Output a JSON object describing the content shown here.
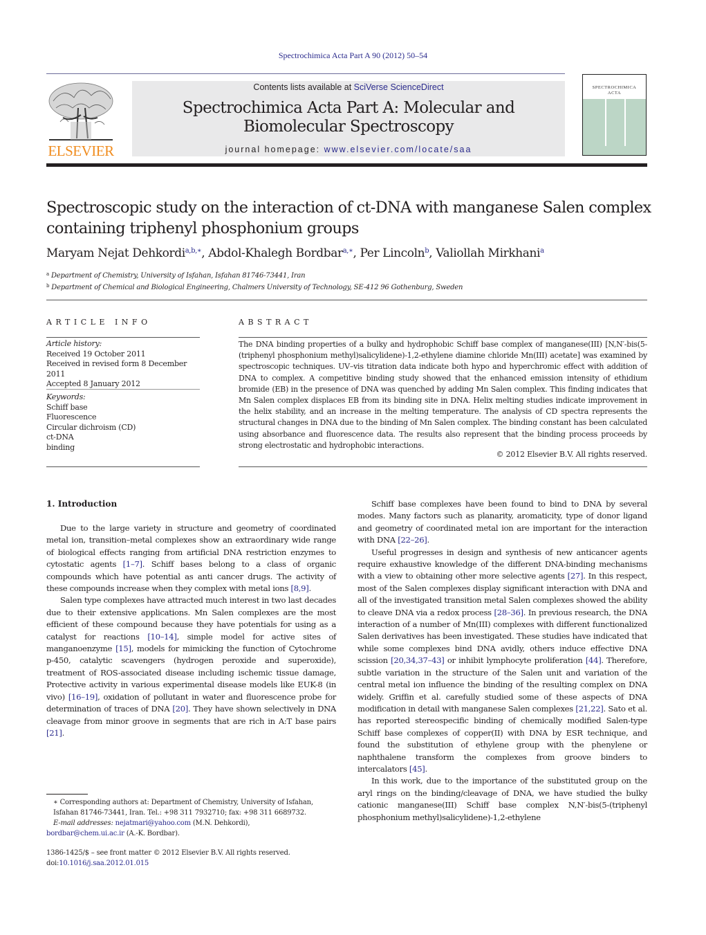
{
  "running_head": "Spectrochimica Acta Part A 90 (2012) 50–54",
  "banner": {
    "contents_prefix": "Contents lists available at ",
    "contents_link": "SciVerse ScienceDirect",
    "journal_title_line1": "Spectrochimica Acta Part A: Molecular and",
    "journal_title_line2": "Biomolecular Spectroscopy",
    "homepage_prefix": "journal homepage: ",
    "homepage_link": "www.elsevier.com/locate/saa"
  },
  "publisher_logo": {
    "icon": "elsevier-tree-logo",
    "text": "ELSEVIER",
    "color": "#f08c1e"
  },
  "cover": {
    "title_line1": "SPECTROCHIMICA",
    "title_line2": "ACTA",
    "color": "#bcd6c6"
  },
  "article": {
    "title_line1": "Spectroscopic study on the interaction of ct-DNA with manganese Salen complex",
    "title_line2": "containing triphenyl phosphonium groups",
    "authors": [
      {
        "name": "Maryam Nejat Dehkordi",
        "sup": "a,b,∗",
        "sep": ", "
      },
      {
        "name": "Abdol-Khalegh Bordbar",
        "sup": "a,∗",
        "sep": ", "
      },
      {
        "name": "Per Lincoln",
        "sup": "b",
        "sep": ", "
      },
      {
        "name": "Valiollah Mirkhani",
        "sup": "a",
        "sep": ""
      }
    ],
    "affiliations": [
      {
        "mark": "a",
        "text": "Department of Chemistry, University of Isfahan, Isfahan 81746-73441, Iran"
      },
      {
        "mark": "b",
        "text": "Department of Chemical and Biological Engineering, Chalmers University of Technology, SE-412 96 Gothenburg, Sweden"
      }
    ]
  },
  "article_info": {
    "heading": "ARTICLE INFO",
    "history_label": "Article history:",
    "history": [
      "Received 19 October 2011",
      "Received in revised form 8 December 2011",
      "Accepted 8 January 2012"
    ],
    "keywords_label": "Keywords:",
    "keywords": [
      "Schiff base",
      "Fluorescence",
      "Circular dichroism (CD)",
      "ct-DNA",
      "binding"
    ]
  },
  "abstract": {
    "heading": "ABSTRACT",
    "text": "The DNA binding properties of a bulky and hydrophobic Schiff base complex of manganese(III) [N,N′-bis(5-(triphenyl phosphonium methyl)salicylidene)-1,2-ethylene diamine chloride Mn(III) acetate] was examined by spectroscopic techniques. UV–vis titration data indicate both hypo and hyperchromic effect with addition of DNA to complex. A competitive binding study showed that the enhanced emission intensity of ethidium bromide (EB) in the presence of DNA was quenched by adding Mn Salen complex. This finding indicates that Mn Salen complex displaces EB from its binding site in DNA. Helix melting studies indicate improvement in the helix stability, and an increase in the melting temperature. The analysis of CD spectra represents the structural changes in DNA due to the binding of Mn Salen complex. The binding constant has been calculated using absorbance and fluorescence data. The results also represent that the binding process proceeds by strong electrostatic and hydrophobic interactions.",
    "copyright": "© 2012 Elsevier B.V. All rights reserved."
  },
  "introduction": {
    "heading": "1.  Introduction",
    "left_paragraphs": [
      [
        {
          "t": "Due to the large variety in structure and geometry of coordinated metal ion, transition–metal complexes show an extraordinary wide range of biological effects ranging from artificial DNA restriction enzymes to cytostatic agents "
        },
        {
          "ref": "[1–7]"
        },
        {
          "t": ". Schiff bases belong to a class of organic compounds which have potential as anti cancer drugs. The activity of these compounds increase when they complex with metal ions "
        },
        {
          "ref": "[8,9]"
        },
        {
          "t": "."
        }
      ],
      [
        {
          "t": "Salen type complexes have attracted much interest in two last decades due to their extensive applications. Mn Salen complexes are the most efficient of these compound because they have potentials for using as a catalyst for reactions "
        },
        {
          "ref": "[10–14]"
        },
        {
          "t": ", simple model for active sites of manganoenzyme "
        },
        {
          "ref": "[15]"
        },
        {
          "t": ", models for mimicking the function of Cytochrome p-450, catalytic scavengers (hydrogen peroxide and superoxide), treatment of ROS-associated disease including ischemic tissue damage, Protective activity in various experimental disease models like EUK-8 (in vivo) "
        },
        {
          "ref": "[16–19]"
        },
        {
          "t": ", oxidation of pollutant in water and fluorescence probe for determination of traces of DNA "
        },
        {
          "ref": "[20]"
        },
        {
          "t": ". They have shown selectively in DNA cleavage from minor groove in segments that are rich in A:T base pairs "
        },
        {
          "ref": "[21]"
        },
        {
          "t": "."
        }
      ]
    ],
    "right_paragraphs": [
      [
        {
          "t": "Schiff base complexes have been found to bind to DNA by several modes. Many factors such as planarity, aromaticity, type of donor ligand and geometry of coordinated metal ion are important for the interaction with DNA "
        },
        {
          "ref": "[22–26]"
        },
        {
          "t": "."
        }
      ],
      [
        {
          "t": "Useful progresses in design and synthesis of new anticancer agents require exhaustive knowledge of the different DNA-binding mechanisms with a view to obtaining other more selective agents "
        },
        {
          "ref": "[27]"
        },
        {
          "t": ". In this respect, most of the Salen complexes display significant interaction with DNA and all of the investigated transition metal Salen complexes showed the ability to cleave DNA via a redox process "
        },
        {
          "ref": "[28–36]"
        },
        {
          "t": ". In previous research, the DNA interaction of a number of Mn(III) complexes with different functionalized Salen derivatives has been investigated. These studies have indicated that while some complexes bind DNA avidly, others induce effective DNA scission "
        },
        {
          "ref": "[20,34,37–43]"
        },
        {
          "t": " or inhibit lymphocyte proliferation "
        },
        {
          "ref": "[44]"
        },
        {
          "t": ". Therefore, subtle variation in the structure of the Salen unit and variation of the central metal ion influence the binding of the resulting complex on DNA widely. Griffin et al. carefully studied some of these aspects of DNA modification in detail with manganese Salen complexes "
        },
        {
          "ref": "[21,22]"
        },
        {
          "t": ". Sato et al. has reported stereospecific binding of chemically modified Salen-type Schiff base complexes of copper(II) with DNA by ESR technique, and found the substitution of ethylene group with the phenylene or naphthalene transform the complexes from groove binders to intercalators "
        },
        {
          "ref": "[45]"
        },
        {
          "t": "."
        }
      ],
      [
        {
          "t": "In this work, due to the importance of the substituted group on the aryl rings on the binding/cleavage of DNA, we have studied the bulky cationic manganese(III) Schiff base complex N,N′-bis(5-(triphenyl phosphonium methyl)salicylidene)-1,2-ethylene"
        }
      ]
    ]
  },
  "footnotes": {
    "corresponding": "∗ Corresponding authors at: Department of Chemistry, University of Isfahan, Isfahan 81746-73441, Iran. Tel.: +98 311 7932710; fax: +98 311 6689732.",
    "email_label": "E-mail addresses: ",
    "email1": "nejatmari@yahoo.com",
    "email1_owner": " (M.N. Dehkordi),",
    "email2": "bordbar@chem.ui.ac.ir",
    "email2_owner": " (A.-K. Bordbar)."
  },
  "front_matter": {
    "issn_line": "1386-1425/$ – see front matter © 2012 Elsevier B.V. All rights reserved.",
    "doi_prefix": "doi:",
    "doi": "10.1016/j.saa.2012.01.015"
  }
}
